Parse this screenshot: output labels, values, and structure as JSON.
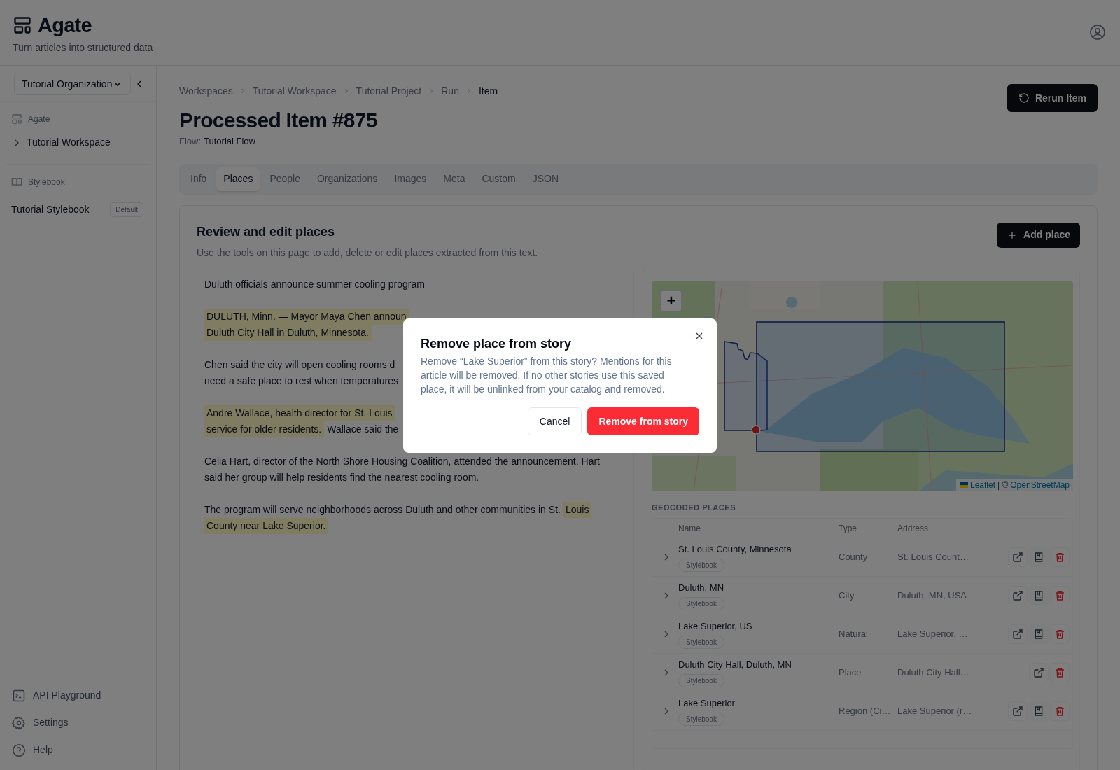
{
  "app": {
    "name": "Agate",
    "tagline": "Turn articles into structured data"
  },
  "sidebar": {
    "organization": "Tutorial Organization",
    "workspaces": {
      "heading": "Agate",
      "items": [
        {
          "label": "Tutorial Workspace",
          "expanded": false
        }
      ]
    },
    "stylebooks": {
      "heading": "Stylebook",
      "items": [
        {
          "label": "Tutorial Stylebook",
          "badge": "Default"
        }
      ]
    },
    "footer": [
      {
        "kind": "terminal",
        "label": "API Playground"
      },
      {
        "kind": "settings",
        "label": "Settings"
      },
      {
        "kind": "help",
        "label": "Help"
      }
    ]
  },
  "breadcrumbs": [
    "Workspaces",
    "Tutorial Workspace",
    "Tutorial Project",
    "Run",
    "Item"
  ],
  "page": {
    "title": "Processed Item #875",
    "flow_label": "Flow:",
    "flow": "Tutorial Flow",
    "rerun_button": "Rerun Item"
  },
  "tabs": [
    {
      "label": "Info",
      "selected": false
    },
    {
      "label": "Places",
      "selected": true
    },
    {
      "label": "People",
      "selected": false
    },
    {
      "label": "Organizations",
      "selected": false
    },
    {
      "label": "Images",
      "selected": false
    },
    {
      "label": "Meta",
      "selected": false
    },
    {
      "label": "Custom",
      "selected": false
    },
    {
      "label": "JSON",
      "selected": false
    }
  ],
  "card": {
    "title": "Review and edit places",
    "subtitle": "Use the tools on this page to add, delete or edit places extracted from this text.",
    "add_button": "Add place"
  },
  "article": [
    [
      [
        {
          "text": "Duluth officials announce summer cooling program",
          "highlighted": false
        }
      ]
    ],
    [
      [
        {
          "text": "DULUTH, Minn. — Mayor Maya Chen announ",
          "highlighted": true
        }
      ],
      [
        {
          "text": "Duluth City Hall in Duluth, Minnesota.",
          "highlighted": true
        }
      ]
    ],
    [
      [
        {
          "text": "Chen said the city will open cooling rooms d",
          "highlighted": false
        }
      ],
      [
        {
          "text": "need a safe place to rest when temperatures",
          "highlighted": false
        }
      ]
    ],
    [
      [
        {
          "text": "Andre Wallace, health director for St. Louis",
          "highlighted": true
        }
      ],
      [
        {
          "text": "service for older residents.",
          "highlighted": true
        },
        {
          "text": "Wallace said the",
          "highlighted": false
        }
      ]
    ],
    [
      [
        {
          "text": "Celia Hart, director of the North Shore Housing Coalition, attended the announcement. Hart",
          "highlighted": false
        }
      ],
      [
        {
          "text": "said her group will help residents find the nearest cooling room.",
          "highlighted": false
        }
      ]
    ],
    [
      [
        {
          "text": "The program will serve neighborhoods across Duluth and other communities in St.",
          "highlighted": false
        },
        {
          "text": "Louis",
          "highlighted": true
        }
      ],
      [
        {
          "text": "County near Lake Superior.",
          "highlighted": true
        }
      ]
    ]
  ],
  "map": {
    "zoom_in": "+",
    "attribution": [
      {
        "text": "Leaflet",
        "link": true
      },
      {
        "text": "| ©",
        "link": false
      },
      {
        "text": "OpenStreetMap",
        "link": true
      }
    ]
  },
  "places": {
    "heading": "GEOCODED PLACES",
    "columns": [
      "Name",
      "Type",
      "Address"
    ],
    "rows": [
      {
        "name": "St. Louis County, Minnesota",
        "tag": "Stylebook",
        "type": "County",
        "address": "St. Louis Count…",
        "saved": true
      },
      {
        "name": "Duluth, MN",
        "tag": "Stylebook",
        "type": "City",
        "address": "Duluth, MN, USA",
        "saved": true
      },
      {
        "name": "Lake Superior, US",
        "tag": "Stylebook",
        "type": "Natural",
        "address": "Lake Superior, …",
        "saved": true
      },
      {
        "name": "Duluth City Hall, Duluth, MN",
        "tag": "Stylebook",
        "type": "Place",
        "address": "Duluth City Hall…",
        "saved": false
      },
      {
        "name": "Lake Superior",
        "tag": "Stylebook",
        "type": "Region (Ci…",
        "address": "Lake Superior (r…",
        "saved": true
      }
    ]
  },
  "dialog": {
    "title": "Remove place from story",
    "body": "Remove “Lake Superior” from this story? Mentions for this article will be removed. If no other stories use this saved place, it will be unlinked from your catalog and removed.",
    "cancel": "Cancel",
    "confirm": "Remove from story"
  }
}
